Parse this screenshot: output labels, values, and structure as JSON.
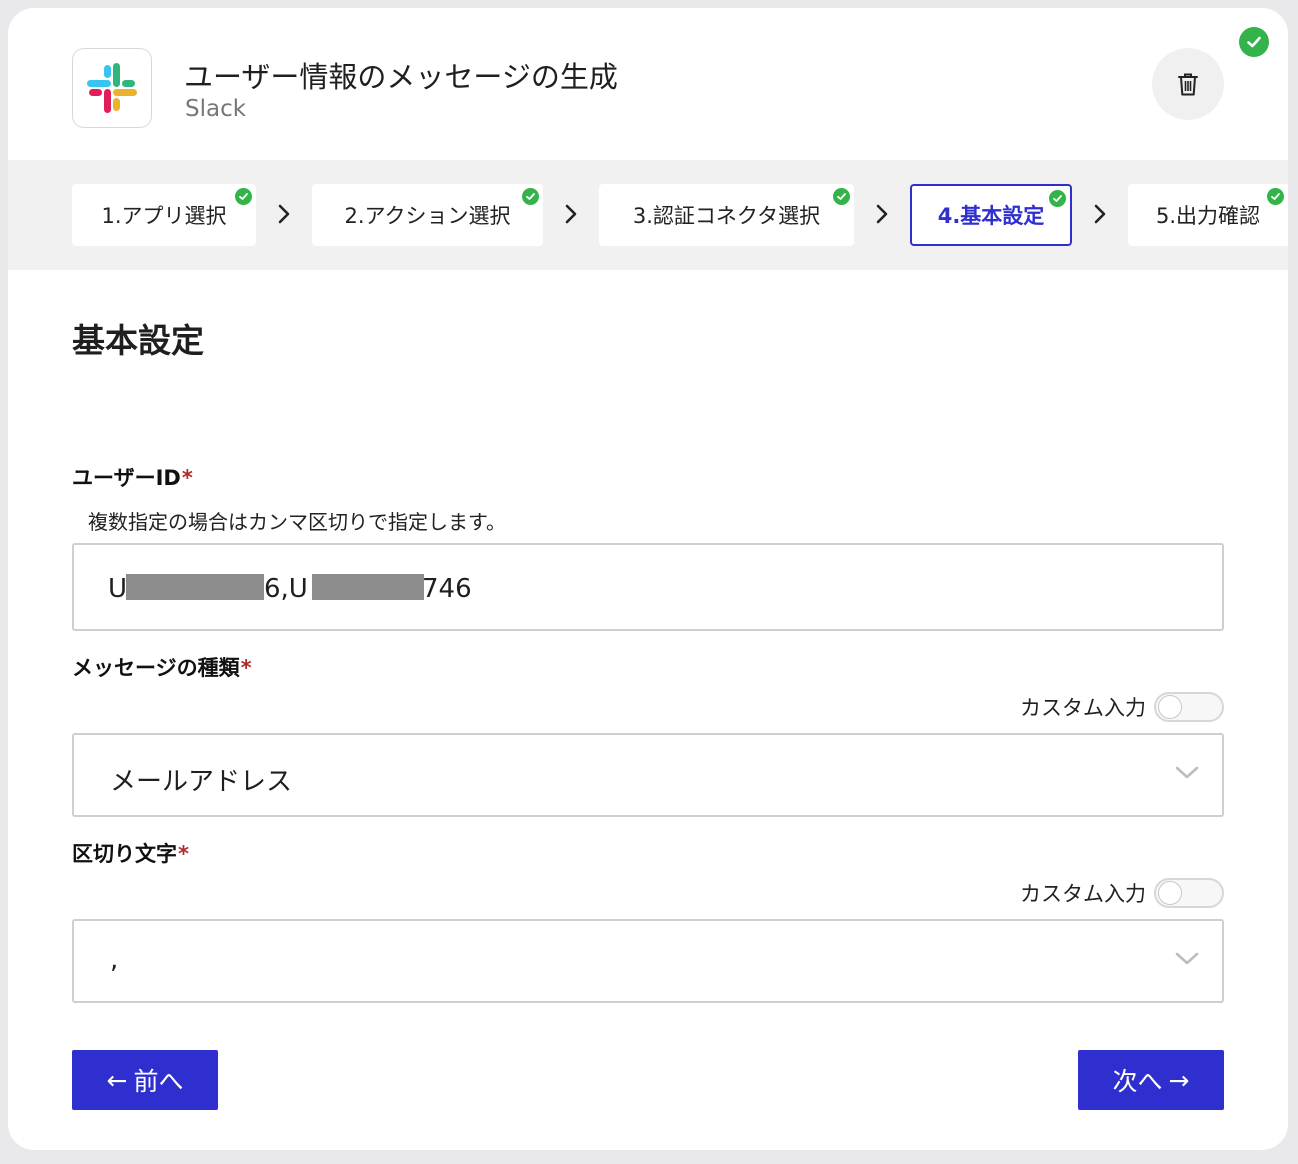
{
  "header": {
    "title": "ユーザー情報のメッセージの生成",
    "app_name": "Slack",
    "app_icon": "slack-logo",
    "status_icon": "check-circle-icon",
    "delete_icon": "trash-icon"
  },
  "stepper": {
    "steps": [
      {
        "label": "1.アプリ選択",
        "completed": true,
        "active": false
      },
      {
        "label": "2.アクション選択",
        "completed": true,
        "active": false
      },
      {
        "label": "3.認証コネクタ選択",
        "completed": true,
        "active": false
      },
      {
        "label": "4.基本設定",
        "completed": true,
        "active": true
      },
      {
        "label": "5.出力確認",
        "completed": true,
        "active": false
      }
    ]
  },
  "main": {
    "section_title": "基本設定",
    "user_id": {
      "label": "ユーザーID",
      "required_mark": "*",
      "help": "複数指定の場合はカンマ区切りで指定します。",
      "value_parts": [
        "U",
        "6,U",
        "746"
      ]
    },
    "message_type": {
      "label": "メッセージの種類",
      "required_mark": "*",
      "custom_label": "カスタム入力",
      "custom_enabled": false,
      "selected": "メールアドレス"
    },
    "delimiter": {
      "label": "区切り文字",
      "required_mark": "*",
      "custom_label": "カスタム入力",
      "custom_enabled": false,
      "selected": ","
    }
  },
  "footer": {
    "prev_label": "前へ",
    "next_label": "次へ",
    "prev_arrow": "←",
    "next_arrow": "→"
  },
  "colors": {
    "accent": "#2f2fd0",
    "success": "#34b34a",
    "required": "#b02a2a"
  }
}
